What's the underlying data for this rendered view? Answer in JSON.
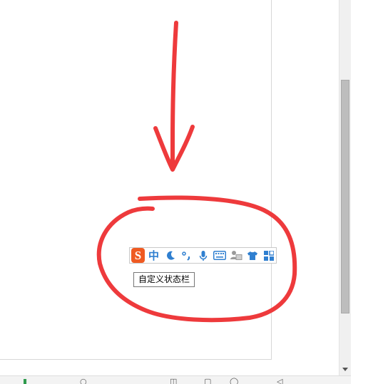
{
  "ime_toolbar": {
    "logo_letter": "S",
    "mode_label": "中",
    "items": [
      "logo-icon",
      "chinese-mode",
      "moon-icon",
      "punctuation-icon",
      "microphone-icon",
      "keyboard-icon",
      "user-card-icon",
      "skin-shirt-icon",
      "toolbox-grid-icon"
    ]
  },
  "tooltip": {
    "text": "自定义状态栏"
  },
  "colors": {
    "annotation_red": "#ee3a3c",
    "ime_blue": "#2f7fd0",
    "ime_logo_orange": "#ef5a22"
  }
}
